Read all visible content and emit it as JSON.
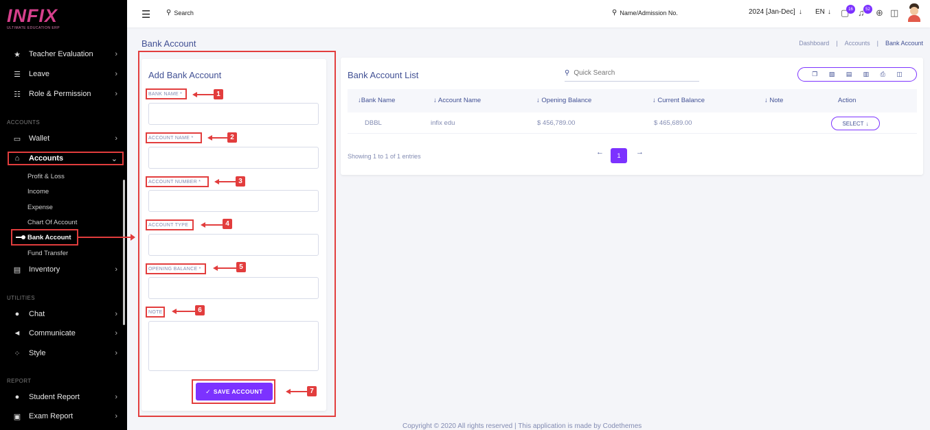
{
  "logo": {
    "main": "INFIX",
    "tagline": "ULTIMATE EDUCATION ERP"
  },
  "sidebar": {
    "items_top": [
      {
        "label": "Teacher Evaluation",
        "icon": "star-icon",
        "glyph": "★"
      },
      {
        "label": "Leave",
        "icon": "leave-icon",
        "glyph": "☰"
      },
      {
        "label": "Role & Permission",
        "icon": "role-icon",
        "glyph": "☷"
      }
    ],
    "section_accounts": "ACCOUNTS",
    "wallet": {
      "label": "Wallet",
      "glyph": "▭"
    },
    "accounts": {
      "label": "Accounts",
      "glyph": "⌂"
    },
    "sub_items": [
      "Profit & Loss",
      "Income",
      "Expense",
      "Chart Of Account",
      "Bank Account",
      "Fund Transfer"
    ],
    "inventory": {
      "label": "Inventory",
      "glyph": "▤"
    },
    "section_utilities": "UTILITIES",
    "utilities": [
      {
        "label": "Chat",
        "icon": "chat-icon",
        "glyph": "●"
      },
      {
        "label": "Communicate",
        "icon": "megaphone-icon",
        "glyph": "◄"
      },
      {
        "label": "Style",
        "icon": "style-icon",
        "glyph": "⁘"
      }
    ],
    "section_report": "REPORT",
    "reports": [
      {
        "label": "Student Report",
        "icon": "users-icon",
        "glyph": "●"
      },
      {
        "label": "Exam Report",
        "icon": "report-icon",
        "glyph": "▣"
      }
    ]
  },
  "topbar": {
    "search": "Search",
    "name_search": "Name/Admission No.",
    "year": "2024 [Jan-Dec]",
    "lang": "EN",
    "chat_badge": "16",
    "notif_badge": "52"
  },
  "page": {
    "title": "Bank Account",
    "breadcrumbs": [
      "Dashboard",
      "Accounts",
      "Bank Account"
    ]
  },
  "form": {
    "title": "Add Bank Account",
    "labels": [
      "BANK NAME *",
      "ACCOUNT NAME *",
      "ACCOUNT NUMBER *",
      "ACCOUNT TYPE",
      "OPENING BALANCE *",
      "NOTE"
    ],
    "save": "SAVE ACCOUNT",
    "callouts": [
      "1",
      "2",
      "3",
      "4",
      "5",
      "6",
      "7"
    ]
  },
  "list": {
    "title": "Bank Account List",
    "search_placeholder": "Quick Search",
    "export_icons": [
      "copy-icon",
      "excel-icon",
      "csv-icon",
      "pdf-icon",
      "print-icon",
      "columns-icon"
    ],
    "columns": [
      "Bank Name",
      "Account Name",
      "Opening Balance",
      "Current Balance",
      "Note",
      "Action"
    ],
    "rows": [
      {
        "bank_name": "DBBL",
        "account_name": "infix edu",
        "opening_balance": "$ 456,789.00",
        "current_balance": "$ 465,689.00",
        "note": "",
        "action": "SELECT"
      }
    ],
    "showing": "Showing 1 to 1 of 1 entries",
    "page": "1"
  },
  "footer": "Copyright © 2020 All rights reserved | This application is made by Codethemes",
  "colors": {
    "accent": "#7c32ff",
    "annotation": "#e23d3d",
    "text": "#415094"
  }
}
